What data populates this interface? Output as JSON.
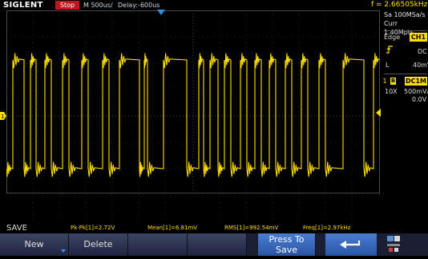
{
  "top": {
    "logo": "SIGLENT",
    "run_state": "Stop",
    "timebase": "M 500us/",
    "delay": "Delay:-600us",
    "freq": "f = 2.66505kHz"
  },
  "acquisition": {
    "sample_rate": "Sa 100MSa/s",
    "memory": "Curr 1.40Mpts"
  },
  "trigger": {
    "mode": "Edge",
    "source": "CH1",
    "coupling": "DC",
    "level_label": "L",
    "level": "40mV"
  },
  "channel": {
    "number": "1",
    "bw_badge": "B",
    "coupling": "DC1M",
    "probe": "10X",
    "scale": "500mV/",
    "offset": "0.0V"
  },
  "measurements": {
    "pkpk": "Pk-Pk[1]=2.72V",
    "mean": "Mean[1]=6.81mV",
    "rms": "RMS[1]=992.54mV",
    "freq": "Freq[1]=2.97kHz"
  },
  "menu": {
    "title": "SAVE",
    "new_label": "New",
    "delete_label": "Delete",
    "press_to_save_line1": "Press To",
    "press_to_save_line2": "Save"
  },
  "colors": {
    "trace": "#ffdf00",
    "stop": "#c8141e",
    "softkey": "#2a3352",
    "accent_blue": "#3f8cff"
  },
  "icons": {
    "trigger_edge": "rising-edge-icon",
    "back": "back-arrow-icon",
    "usb": "usb-icon"
  }
}
